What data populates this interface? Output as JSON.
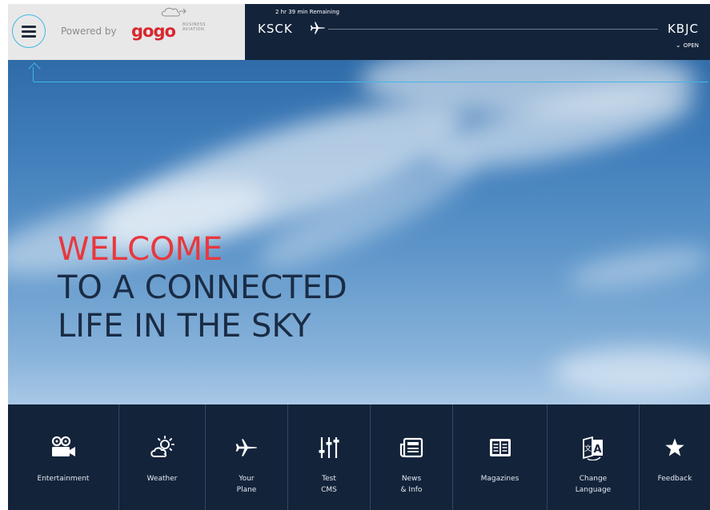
{
  "header": {
    "powered_by": "Powered by",
    "brand": {
      "name": "gogo",
      "sub_line1": "BUSINESS",
      "sub_line2": "AVIATION",
      "color": "#d7282f"
    },
    "menu_icon": "hamburger-menu-icon"
  },
  "flight": {
    "remaining": "2 hr 39 min Remaining",
    "origin": "KSCK",
    "destination": "KBJC",
    "open_label": "OPEN",
    "plane_icon": "airplane-icon"
  },
  "hero": {
    "line1": "WELCOME",
    "line2": "TO A CONNECTED",
    "line3": "LIFE IN THE SKY",
    "accent_color": "#e8383d",
    "text_color": "#1a2c45"
  },
  "nav": {
    "items": [
      {
        "label": "Entertainment",
        "icon": "film-camera-icon"
      },
      {
        "label": "Weather",
        "icon": "sun-cloud-icon"
      },
      {
        "label": "Your\nPlane",
        "icon": "airplane-icon"
      },
      {
        "label": "Test\nCMS",
        "icon": "sliders-icon"
      },
      {
        "label": "News\n& Info",
        "icon": "newspaper-icon"
      },
      {
        "label": "Magazines",
        "icon": "magazine-icon"
      },
      {
        "label": "Change\nLanguage",
        "icon": "translate-icon"
      },
      {
        "label": "Feedback",
        "icon": "star-icon"
      }
    ]
  },
  "colors": {
    "navy": "#13233a",
    "accent_blue": "#41b6e6",
    "brand_panel": "#e8e8e8"
  }
}
